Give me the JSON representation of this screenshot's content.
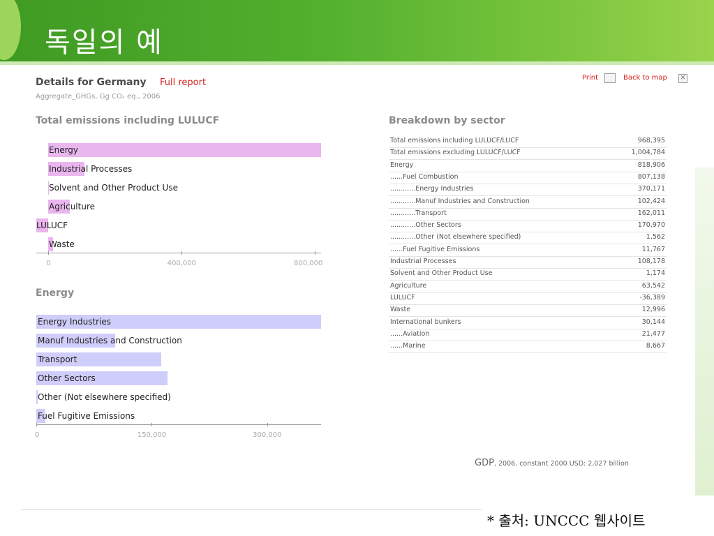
{
  "slide": {
    "title": "독일의 예"
  },
  "header": {
    "title": "Details for Germany",
    "link": "Full report",
    "subtitle": "Aggregate_GHGs, Gg CO₂ eq., 2006",
    "print_label": "Print",
    "back_label": "Back to map"
  },
  "sections": {
    "total": "Total emissions including LULUCF",
    "energy": "Energy",
    "breakdown": "Breakdown by sector"
  },
  "colors": {
    "total_bar": "#e9b6ee",
    "energy_bar": "#cfcdf9",
    "title_bar": "#4aa828",
    "link": "#d81e1e"
  },
  "chart_data": [
    {
      "type": "bar",
      "orientation": "horizontal",
      "title": "Total emissions including LULUCF",
      "categories": [
        "Energy",
        "Industrial Processes",
        "Solvent and Other Product Use",
        "Agriculture",
        "LULUCF",
        "Waste"
      ],
      "values": [
        818906,
        108178,
        1174,
        63542,
        -36389,
        12996
      ],
      "xlim": [
        -36389,
        818906
      ],
      "ticks": [
        "0",
        "400,000",
        "800,000"
      ],
      "tick_values": [
        0,
        400000,
        800000
      ]
    },
    {
      "type": "bar",
      "orientation": "horizontal",
      "title": "Energy",
      "categories": [
        "Energy Industries",
        "Manuf Industries and Construction",
        "Transport",
        "Other Sectors",
        "Other (Not elsewhere specified)",
        "Fuel Fugitive Emissions"
      ],
      "values": [
        370171,
        102424,
        162011,
        170970,
        1562,
        11767
      ],
      "xlim": [
        0,
        370171
      ],
      "ticks": [
        "0",
        "150,000",
        "300,000"
      ],
      "tick_values": [
        0,
        150000,
        300000
      ]
    },
    {
      "type": "table",
      "title": "Breakdown by sector",
      "rows": [
        {
          "label": "Total emissions including LULUCF/LUCF",
          "value": "968,395"
        },
        {
          "label": "Total emissions excluding LULUCF/LUCF",
          "value": "1,004,784"
        },
        {
          "label": "Energy",
          "value": "818,906"
        },
        {
          "label": "......Fuel Combustion",
          "value": "807,138"
        },
        {
          "label": "............Energy Industries",
          "value": "370,171"
        },
        {
          "label": "............Manuf Industries and Construction",
          "value": "102,424"
        },
        {
          "label": "............Transport",
          "value": "162,011"
        },
        {
          "label": "............Other Sectors",
          "value": "170,970"
        },
        {
          "label": "............Other (Not elsewhere specified)",
          "value": "1,562"
        },
        {
          "label": "......Fuel Fugitive Emissions",
          "value": "11,767"
        },
        {
          "label": "Industrial Processes",
          "value": "108,178"
        },
        {
          "label": "Solvent and Other Product Use",
          "value": "1,174"
        },
        {
          "label": "Agriculture",
          "value": "63,542"
        },
        {
          "label": "LULUCF",
          "value": "-36,389"
        },
        {
          "label": "Waste",
          "value": "12,996"
        },
        {
          "label": "International bunkers",
          "value": "30,144"
        },
        {
          "label": "......Aviation",
          "value": "21,477"
        },
        {
          "label": "......Marine",
          "value": "8,667"
        }
      ]
    }
  ],
  "gdp": {
    "key": "GDP",
    "text": ", 2006, constant 2000 USD: 2,027 billion"
  },
  "footer": {
    "note": "* 출처: UNCCC 웹사이트"
  }
}
